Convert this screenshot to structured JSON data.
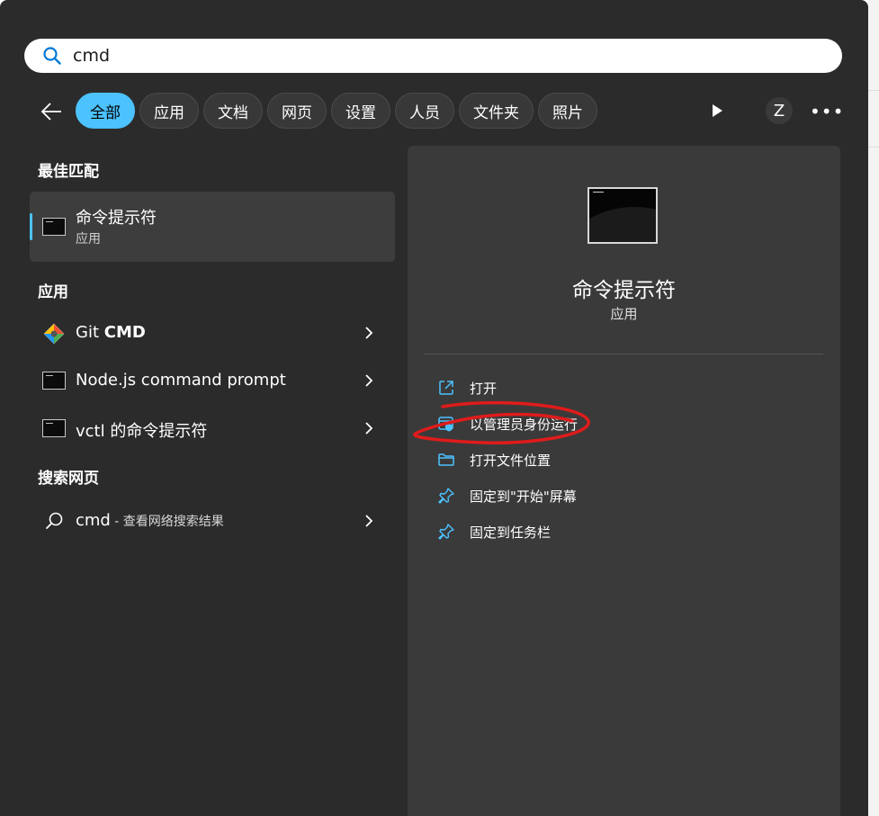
{
  "search": {
    "value": "cmd"
  },
  "filters": [
    {
      "label": "全部",
      "active": true
    },
    {
      "label": "应用"
    },
    {
      "label": "文档"
    },
    {
      "label": "网页"
    },
    {
      "label": "设置"
    },
    {
      "label": "人员"
    },
    {
      "label": "文件夹"
    },
    {
      "label": "照片"
    }
  ],
  "account": {
    "initial": "Z"
  },
  "more_label": "•••",
  "best_match": {
    "heading": "最佳匹配",
    "title": "命令提示符",
    "subtitle": "应用"
  },
  "apps": {
    "heading": "应用",
    "items": [
      {
        "prefix": "Git ",
        "bold": "CMD"
      },
      {
        "prefix": "Node.js command prompt",
        "bold": ""
      },
      {
        "prefix": "vctl 的命令提示符",
        "bold": ""
      }
    ]
  },
  "web": {
    "heading": "搜索网页",
    "query": "cmd",
    "suffix": " - 查看网络搜索结果"
  },
  "detail": {
    "title": "命令提示符",
    "subtitle": "应用",
    "actions": [
      {
        "label": "打开",
        "icon": "open-external-icon"
      },
      {
        "label": "以管理员身份运行",
        "icon": "shield-window-icon"
      },
      {
        "label": "打开文件位置",
        "icon": "folder-icon"
      },
      {
        "label": "固定到\"开始\"屏幕",
        "icon": "pin-icon"
      },
      {
        "label": "固定到任务栏",
        "icon": "pin-icon"
      }
    ]
  },
  "colors": {
    "accent": "#4cc2ff",
    "panel": "#2b2b2b",
    "detail": "#3a3a3a",
    "annotation": "#e01b1b"
  }
}
